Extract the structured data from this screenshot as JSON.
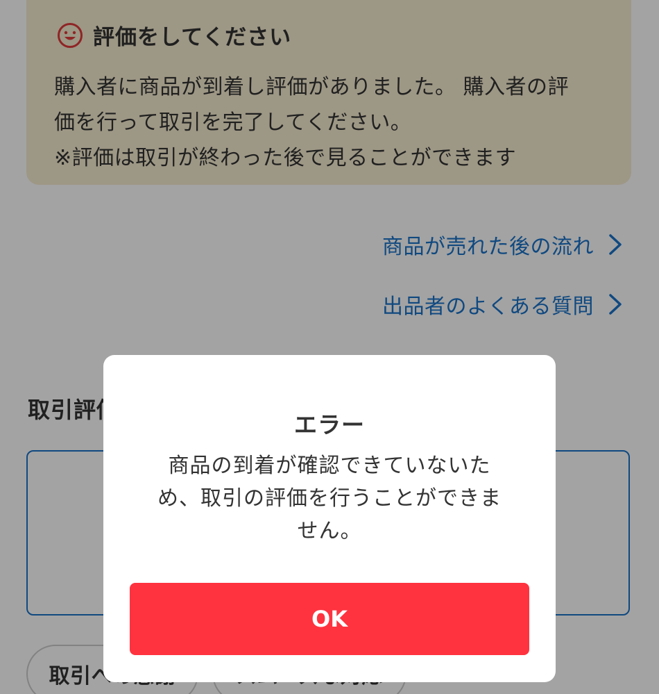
{
  "notice": {
    "title": "評価をしてください",
    "body_line_1": "購入者に商品が到着し評価がありました。 購入者の評",
    "body_line_2": "価を行って取引を完了してください。",
    "body_line_3": "※評価は取引が終わった後で見ることができます",
    "icon": "smile-icon"
  },
  "links": {
    "flow_label": "商品が売れた後の流れ",
    "faq_label": "出品者のよくある質問",
    "icon": "chevron-right-icon"
  },
  "section": {
    "title": "取引評価"
  },
  "buttons": {
    "thanks_label": "取引への感謝",
    "other_label": "スムーズな対応"
  },
  "modal": {
    "title": "エラー",
    "message_line_1": "商品の到着が確認できていないた",
    "message_line_2": "め、取引の評価を行うことができま",
    "message_line_3": "せん。",
    "ok_label": "OK"
  },
  "colors": {
    "notice_bg": "#f6ecd0",
    "link": "#1a73c8",
    "ok_button": "#ff333f",
    "overlay": "rgba(0,0,0,0.36)"
  }
}
